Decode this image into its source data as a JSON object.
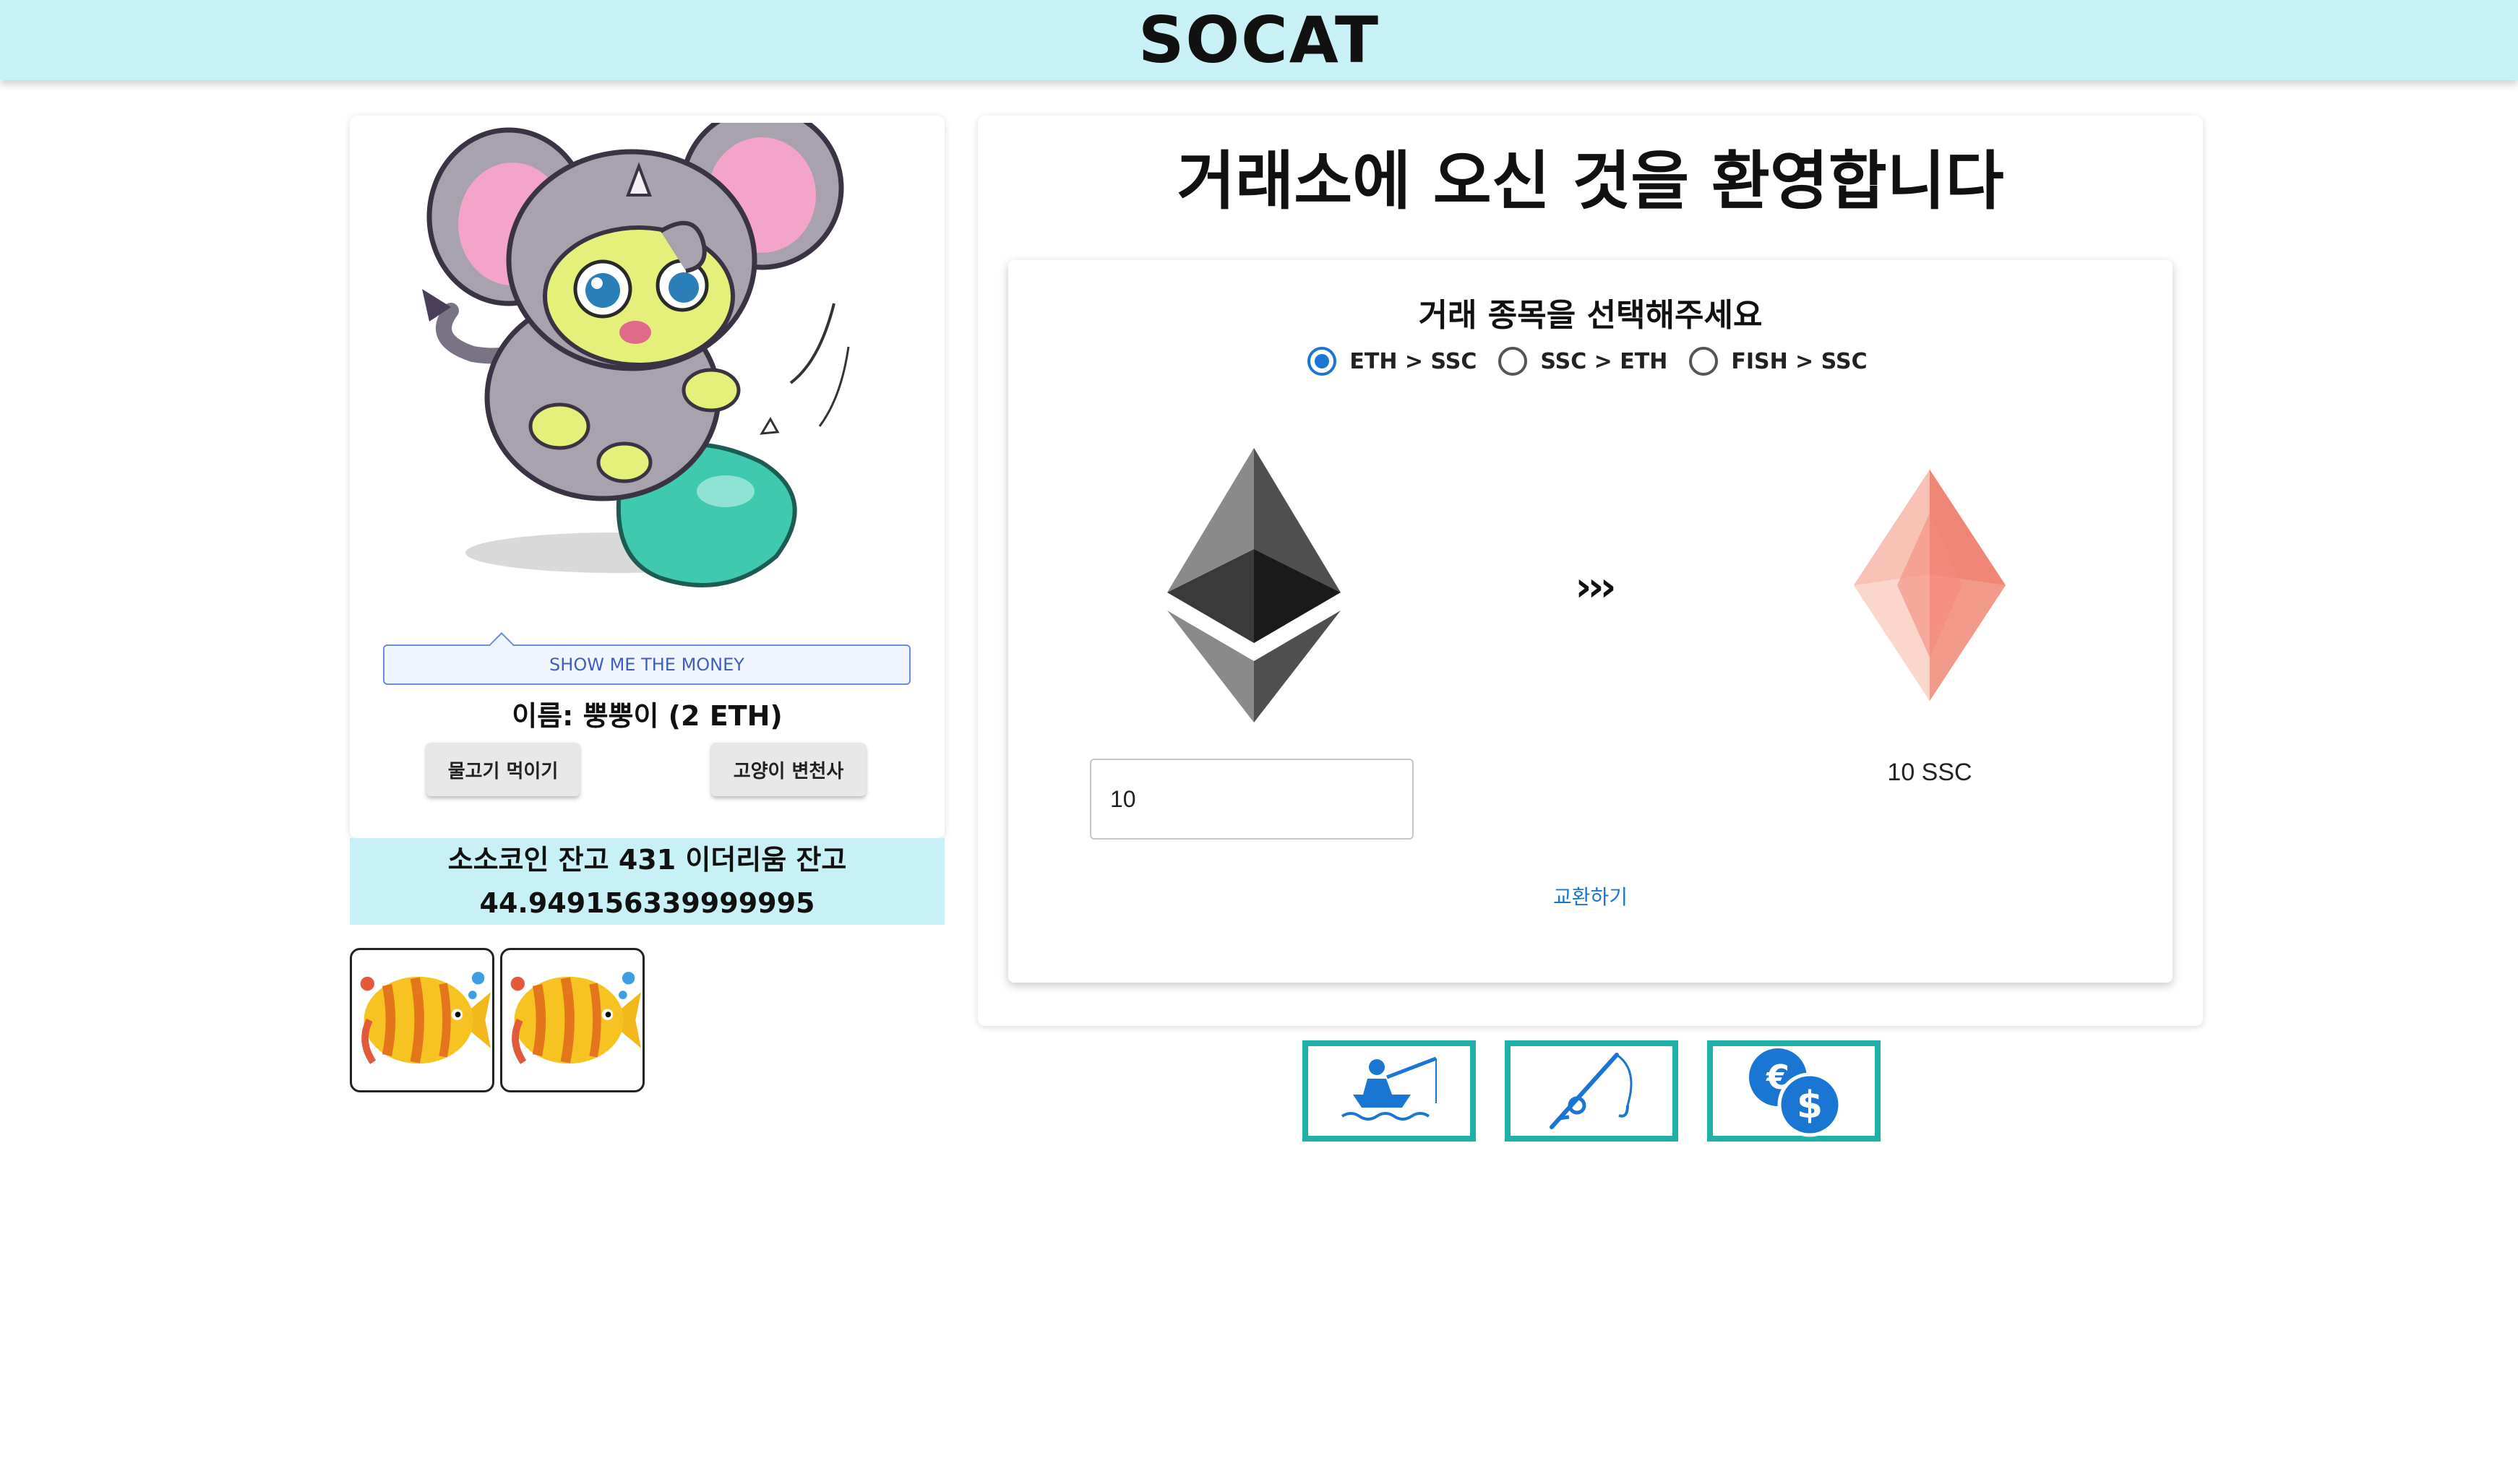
{
  "header": {
    "title": "SOCAT"
  },
  "cat_card": {
    "image_alt": "cat-in-elephant-costume",
    "money_button": "SHOW ME THE MONEY",
    "name_text": "이름: 뿡뿡이 (2 ETH)",
    "feed_button": "물고기 먹이기",
    "attorney_button": "고양이 변천사"
  },
  "balance": {
    "line1": "소소코인 잔고 431 이더리움 잔고",
    "line2": "44.949156339999995"
  },
  "fish": [
    {
      "icon": "fish-icon"
    },
    {
      "icon": "fish-icon"
    }
  ],
  "exchange": {
    "welcome": "거래소에 오신 것을 환영합니다",
    "select_title": "거래 종목을 선택해주세요",
    "options": [
      {
        "label": "ETH > SSC",
        "selected": true
      },
      {
        "label": "SSC > ETH",
        "selected": false
      },
      {
        "label": "FISH > SSC",
        "selected": false
      }
    ],
    "arrows": "›››",
    "input_value": "10",
    "output_text": "10 SSC",
    "swap_button": "교환하기"
  },
  "actions": [
    {
      "icon": "fishing-boat-icon"
    },
    {
      "icon": "fishing-rod-icon"
    },
    {
      "icon": "currency-exchange-icon"
    }
  ],
  "colors": {
    "header_bg": "#c8f0f7",
    "accent": "#1976d2",
    "action_border": "#1fb0a7"
  }
}
